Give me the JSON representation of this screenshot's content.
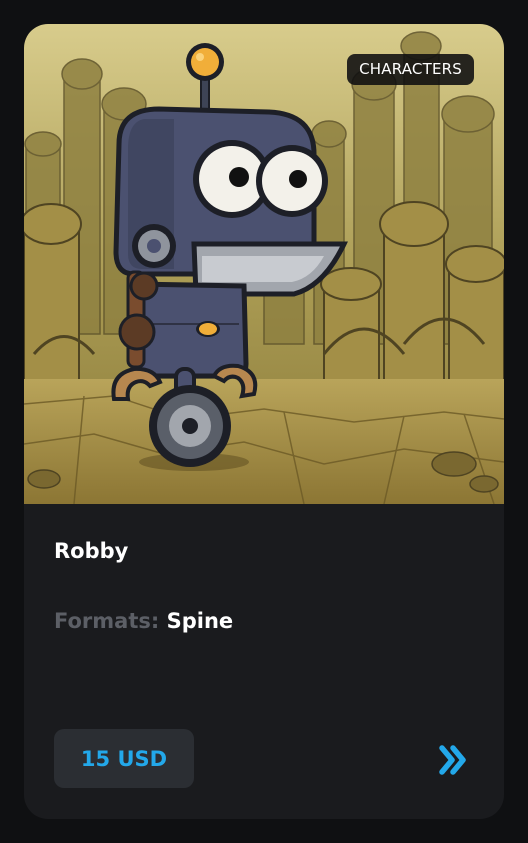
{
  "card": {
    "badge": "CHARACTERS",
    "title": "Robby",
    "formats_label": "Formats:",
    "formats_value": "Spine",
    "price": "15 USD",
    "details_icon": "double-chevron-right-icon"
  },
  "colors": {
    "card_background": "#1a1b1e",
    "page_background": "#0f1012",
    "accent": "#23a8ea",
    "price_button_background": "#2b2e33",
    "muted_text": "#5c5f66"
  }
}
